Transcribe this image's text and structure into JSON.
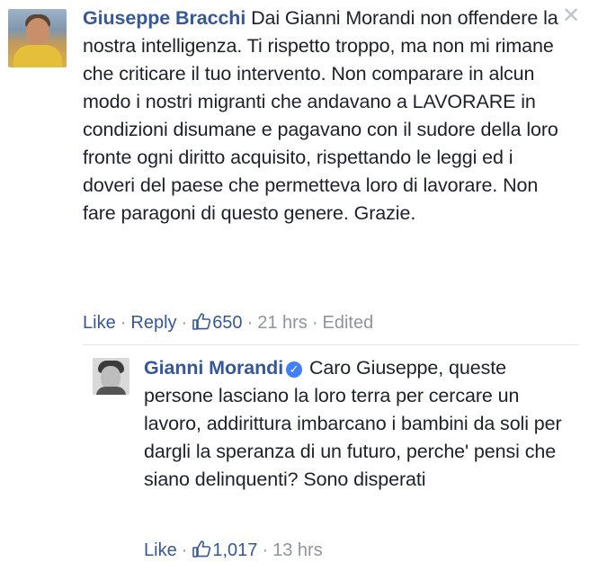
{
  "comments": [
    {
      "author": "Giuseppe Bracchi",
      "text": "Dai Gianni Morandi non offendere la nostra intelligenza. Ti rispetto troppo, ma non mi rimane che criticare il tuo intervento. Non comparare in alcun modo i nostri migranti che andavano a LAVORARE in condizioni disumane e pagavano con il sudore della loro fronte ogni diritto acquisito, rispettando le leggi ed i doveri del paese che permetteva loro di lavorare. Non fare paragoni di questo genere. Grazie.",
      "like_label": "Like",
      "reply_label": "Reply",
      "likes": "650",
      "time": "21 hrs",
      "edited": "Edited",
      "avatar_icon": "profile-photo"
    },
    {
      "author": "Gianni Morandi",
      "verified_icon": "verified-badge-icon",
      "text": "Caro Giuseppe, queste persone lasciano la loro terra per cercare un lavoro, addirittura imbarcano i bambini da soli per dargli la speranza di un futuro, perche' pensi che siano delinquenti? Sono disperati",
      "like_label": "Like",
      "likes": "1,017",
      "time": "13 hrs",
      "avatar_icon": "profile-photo"
    }
  ],
  "colors": {
    "link": "#365899",
    "muted": "#90949c",
    "text": "#1d2129",
    "verified": "#4080ff"
  },
  "close_icon": "close-icon"
}
